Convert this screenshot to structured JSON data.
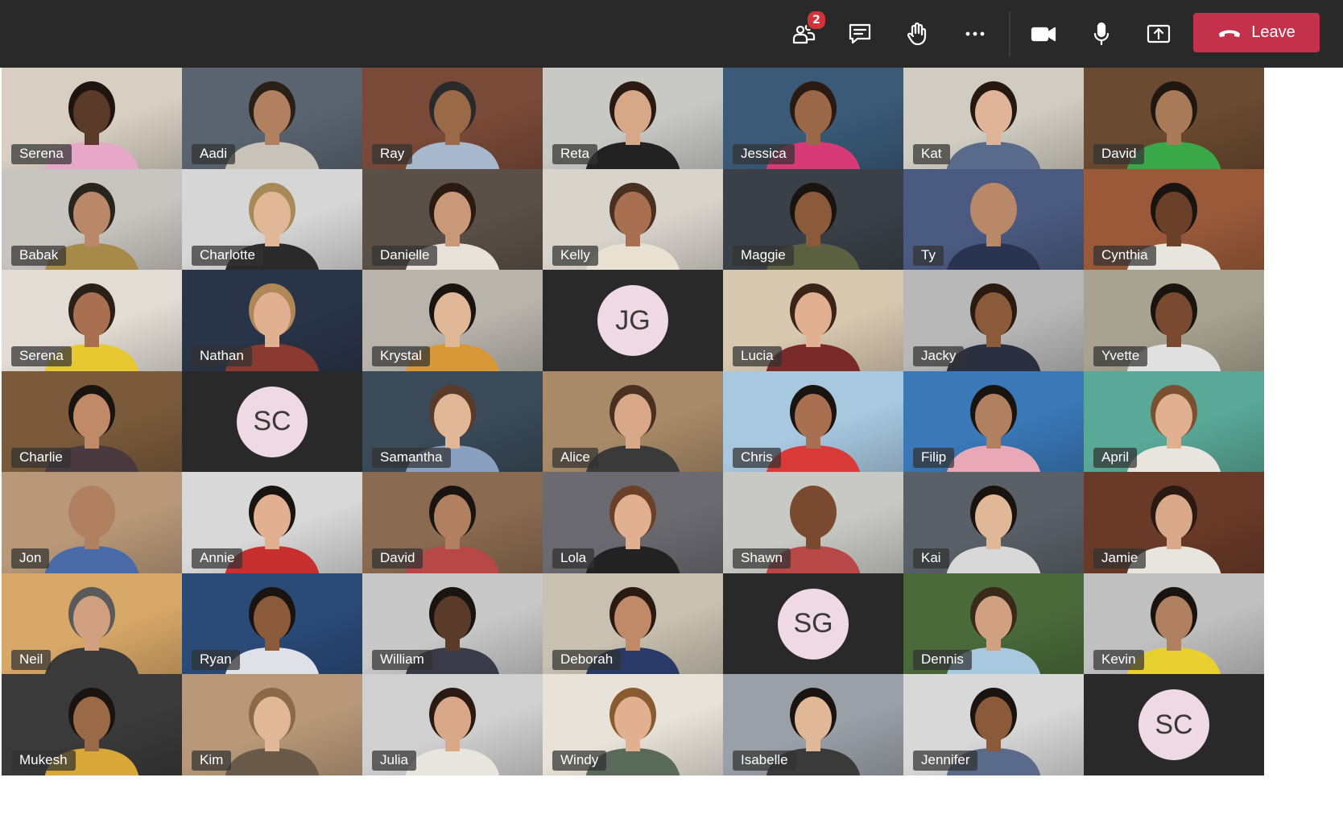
{
  "toolbar": {
    "participants_badge": "2",
    "leave_label": "Leave",
    "icons": {
      "participants": "participants-icon",
      "chat": "chat-icon",
      "raise_hand": "raise-hand-icon",
      "more": "more-options-icon",
      "camera": "camera-icon",
      "mic": "microphone-icon",
      "share": "share-screen-icon",
      "leave": "hang-up-icon"
    },
    "colors": {
      "bar": "#292929",
      "leave": "#c4314b",
      "badge": "#d13438"
    }
  },
  "grid": {
    "columns": 7,
    "rows": 7,
    "participants": [
      {
        "name": "Serena",
        "bg": "#d8cfc2",
        "skin": "#5a3a28",
        "shirt": "#e7a8c8",
        "hair": "#1f1410"
      },
      {
        "name": "Aadi",
        "bg": "#5a6470",
        "skin": "#b08060",
        "shirt": "#c8c2b8",
        "hair": "#2a2018"
      },
      {
        "name": "Ray",
        "bg": "#7a4a38",
        "skin": "#9a6a48",
        "shirt": "#a8b8cc",
        "hair": "#2a2a2a"
      },
      {
        "name": "Reta",
        "bg": "#c8c8c4",
        "skin": "#d6a888",
        "shirt": "#222222",
        "hair": "#2a1a12"
      },
      {
        "name": "Jessica",
        "bg": "#3a5a78",
        "skin": "#9a6848",
        "shirt": "#d83a78",
        "hair": "#2a1a12"
      },
      {
        "name": "Kat",
        "bg": "#d0ccc2",
        "skin": "#e0b498",
        "shirt": "#5a6a8a",
        "hair": "#241810"
      },
      {
        "name": "David",
        "bg": "#6a4a30",
        "skin": "#a87a58",
        "shirt": "#3aa848",
        "hair": "#201810"
      },
      {
        "name": "Babak",
        "bg": "#c8c4c0",
        "skin": "#b88868",
        "shirt": "#a88a48",
        "hair": "#2a241e"
      },
      {
        "name": "Charlotte",
        "bg": "#d6d6d6",
        "skin": "#e0b898",
        "shirt": "#2a2a2a",
        "hair": "#a88a58"
      },
      {
        "name": "Danielle",
        "bg": "#5a5048",
        "skin": "#c89878",
        "shirt": "#e8e2da",
        "hair": "#2a1a12"
      },
      {
        "name": "Kelly",
        "bg": "#d8d4cc",
        "skin": "#a87050",
        "shirt": "#e8e0d0",
        "hair": "#4a3020"
      },
      {
        "name": "Maggie",
        "bg": "#3a4048",
        "skin": "#8a5a3a",
        "shirt": "#5a6040",
        "hair": "#1a1410"
      },
      {
        "name": "Ty",
        "bg": "#4a5a80",
        "skin": "#b88868",
        "shirt": "#2a3450",
        "hair": "#b88868"
      },
      {
        "name": "Cynthia",
        "bg": "#9a5a3a",
        "skin": "#6a4028",
        "shirt": "#e8e4de",
        "hair": "#1a1410"
      },
      {
        "name": "Serena",
        "bg": "#e2dcd4",
        "skin": "#a87050",
        "shirt": "#e8c830",
        "hair": "#2a2018"
      },
      {
        "name": "Nathan",
        "bg": "#2a3448",
        "skin": "#e0b090",
        "shirt": "#8a3a30",
        "hair": "#b08858"
      },
      {
        "name": "Krystal",
        "bg": "#b8b4ac",
        "skin": "#e0b898",
        "shirt": "#d89838",
        "hair": "#1a1410"
      },
      {
        "initials": "JG"
      },
      {
        "name": "Lucia",
        "bg": "#d8c8b0",
        "skin": "#e0b090",
        "shirt": "#7a2a28",
        "hair": "#3a2418"
      },
      {
        "name": "Jacky",
        "bg": "#b8b8b8",
        "skin": "#8a5a3a",
        "shirt": "#2a3040",
        "hair": "#2a1a10"
      },
      {
        "name": "Yvette",
        "bg": "#a8a290",
        "skin": "#7a4a30",
        "shirt": "#e0e0e0",
        "hair": "#1a1410"
      },
      {
        "name": "Charlie",
        "bg": "#7a5a3a",
        "skin": "#c08a68",
        "shirt": "#4a3a40",
        "hair": "#1a1410"
      },
      {
        "initials": "SC"
      },
      {
        "name": "Samantha",
        "bg": "#3a4a58",
        "skin": "#e0b898",
        "shirt": "#8aa0c0",
        "hair": "#5a3a28"
      },
      {
        "name": "Alice",
        "bg": "#a88a68",
        "skin": "#d8a888",
        "shirt": "#3a3a3a",
        "hair": "#4a3020"
      },
      {
        "name": "Chris",
        "bg": "#a8c8e0",
        "skin": "#a87050",
        "shirt": "#d83a38",
        "hair": "#1a1410"
      },
      {
        "name": "Filip",
        "bg": "#3a78b8",
        "skin": "#b08060",
        "shirt": "#e8a8b8",
        "hair": "#1a1410"
      },
      {
        "name": "April",
        "bg": "#5aa898",
        "skin": "#e0b090",
        "shirt": "#e8e4de",
        "hair": "#7a5030"
      },
      {
        "name": "Jon",
        "bg": "#b89878",
        "skin": "#b08060",
        "shirt": "#4a6aa8",
        "hair": "#b08060"
      },
      {
        "name": "Annie",
        "bg": "#d8d8d8",
        "skin": "#e0b090",
        "shirt": "#c83030",
        "hair": "#1a1410"
      },
      {
        "name": "David",
        "bg": "#8a6a50",
        "skin": "#b08060",
        "shirt": "#b84848",
        "hair": "#1a1410"
      },
      {
        "name": "Lola",
        "bg": "#6a6a70",
        "skin": "#e0b090",
        "shirt": "#222222",
        "hair": "#6a4028"
      },
      {
        "name": "Shawn",
        "bg": "#c8c8c4",
        "skin": "#7a4a30",
        "shirt": "#b84848",
        "hair": "#7a4a30"
      },
      {
        "name": "Kai",
        "bg": "#5a6068",
        "skin": "#e0b898",
        "shirt": "#d8d8d8",
        "hair": "#1a1410"
      },
      {
        "name": "Jamie",
        "bg": "#6a3a28",
        "skin": "#d8a888",
        "shirt": "#e8e4de",
        "hair": "#2a1a12"
      },
      {
        "name": "Neil",
        "bg": "#d8a868",
        "skin": "#d0a080",
        "shirt": "#3a3a3a",
        "hair": "#5a5a5a"
      },
      {
        "name": "Ryan",
        "bg": "#2a4a78",
        "skin": "#8a5a3a",
        "shirt": "#e0e0e8",
        "hair": "#1a1410"
      },
      {
        "name": "William",
        "bg": "#c8c8c8",
        "skin": "#5a3a28",
        "shirt": "#3a3a48",
        "hair": "#1a1410"
      },
      {
        "name": "Deborah",
        "bg": "#c8c0b0",
        "skin": "#c08a68",
        "shirt": "#2a3a68",
        "hair": "#2a1a12"
      },
      {
        "initials": "SG"
      },
      {
        "name": "Dennis",
        "bg": "#4a6a3a",
        "skin": "#d0a080",
        "shirt": "#a8c8e0",
        "hair": "#3a2a1a"
      },
      {
        "name": "Kevin",
        "bg": "#c0c0c0",
        "skin": "#b08060",
        "shirt": "#e8d030",
        "hair": "#1a1410"
      },
      {
        "name": "Mukesh",
        "bg": "#3a3a3a",
        "skin": "#9a6a48",
        "shirt": "#d8a838",
        "hair": "#1a1410"
      },
      {
        "name": "Kim",
        "bg": "#b89878",
        "skin": "#e0b898",
        "shirt": "#6a5a4a",
        "hair": "#8a6a48"
      },
      {
        "name": "Julia",
        "bg": "#d0d0d0",
        "skin": "#d8a888",
        "shirt": "#e8e4de",
        "hair": "#2a1a12"
      },
      {
        "name": "Windy",
        "bg": "#e8e2d8",
        "skin": "#e0b090",
        "shirt": "#5a6a5a",
        "hair": "#8a5a30"
      },
      {
        "name": "Isabelle",
        "bg": "#9aa0a8",
        "skin": "#e0b898",
        "shirt": "#3a3a3a",
        "hair": "#1a1410"
      },
      {
        "name": "Jennifer",
        "bg": "#d8d8d8",
        "skin": "#8a5a3a",
        "shirt": "#5a6a8a",
        "hair": "#1a1410"
      },
      {
        "initials": "SC"
      }
    ]
  }
}
